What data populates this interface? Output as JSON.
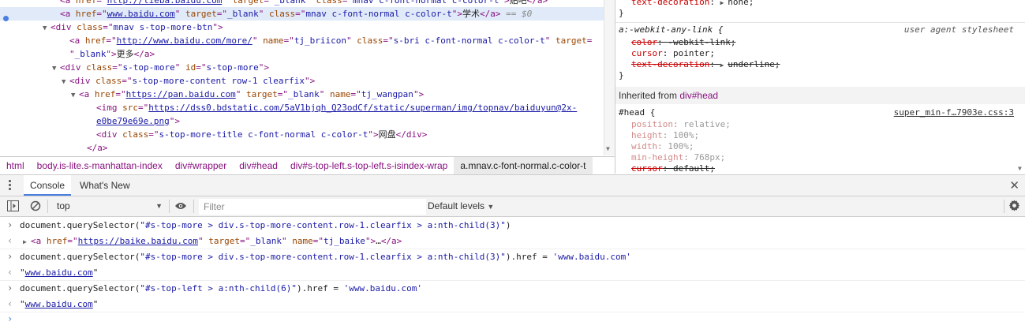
{
  "elements_panel": {
    "lines": [
      {
        "indent": 76,
        "tri": "",
        "parts": [
          [
            "tag",
            "<a "
          ],
          [
            "attr",
            "href"
          ],
          [
            "tag",
            "=\""
          ],
          [
            "url",
            "http://tieba.baidu.com"
          ],
          [
            "tag",
            "\" "
          ],
          [
            "attr",
            "target"
          ],
          [
            "tag",
            "=\""
          ],
          [
            "val",
            "_blank"
          ],
          [
            "tag",
            "\" "
          ],
          [
            "attr",
            "class"
          ],
          [
            "tag",
            "=\""
          ],
          [
            "val",
            "mnav c-font-normal c-color-t"
          ],
          [
            "tag",
            "\">"
          ],
          [
            "txt",
            "贴吧"
          ],
          [
            "tag",
            "</a>"
          ]
        ]
      },
      {
        "indent": 76,
        "tri": "",
        "parts": [
          [
            "tag",
            "<a "
          ],
          [
            "attr",
            "href"
          ],
          [
            "tag",
            "=\""
          ],
          [
            "url",
            "www.baidu.com"
          ],
          [
            "tag",
            "\" "
          ],
          [
            "attr",
            "target"
          ],
          [
            "tag",
            "=\""
          ],
          [
            "val",
            "_blank"
          ],
          [
            "tag",
            "\" "
          ],
          [
            "attr",
            "class"
          ],
          [
            "tag",
            "=\""
          ],
          [
            "val",
            "mnav c-font-normal c-color-t"
          ],
          [
            "tag",
            "\">"
          ],
          [
            "txt",
            "学术"
          ],
          [
            "tag",
            "</a>"
          ],
          [
            "dim",
            " == $0"
          ]
        ]
      },
      {
        "indent": 64,
        "tri": "▼",
        "parts": [
          [
            "tag",
            "<div "
          ],
          [
            "attr",
            "class"
          ],
          [
            "tag",
            "=\""
          ],
          [
            "val",
            "mnav s-top-more-btn"
          ],
          [
            "tag",
            "\">"
          ]
        ]
      },
      {
        "indent": 88,
        "tri": "",
        "parts": [
          [
            "tag",
            "<a "
          ],
          [
            "attr",
            "href"
          ],
          [
            "tag",
            "=\""
          ],
          [
            "url",
            "http://www.baidu.com/more/"
          ],
          [
            "tag",
            "\" "
          ],
          [
            "attr",
            "name"
          ],
          [
            "tag",
            "=\""
          ],
          [
            "val",
            "tj_briicon"
          ],
          [
            "tag",
            "\" "
          ],
          [
            "attr",
            "class"
          ],
          [
            "tag",
            "=\""
          ],
          [
            "val",
            "s-bri c-font-normal c-color-t"
          ],
          [
            "tag",
            "\" "
          ],
          [
            "attr",
            "target"
          ],
          [
            "tag",
            "="
          ]
        ]
      },
      {
        "indent": 88,
        "tri": "",
        "parts": [
          [
            "tag",
            "\""
          ],
          [
            "val",
            "_blank"
          ],
          [
            "tag",
            "\">"
          ],
          [
            "txt",
            "更多"
          ],
          [
            "tag",
            "</a>"
          ]
        ]
      },
      {
        "indent": 76,
        "tri": "▼",
        "parts": [
          [
            "tag",
            "<div "
          ],
          [
            "attr",
            "class"
          ],
          [
            "tag",
            "=\""
          ],
          [
            "val",
            "s-top-more"
          ],
          [
            "tag",
            "\" "
          ],
          [
            "attr",
            "id"
          ],
          [
            "tag",
            "=\""
          ],
          [
            "val",
            "s-top-more"
          ],
          [
            "tag",
            "\">"
          ]
        ]
      },
      {
        "indent": 88,
        "tri": "▼",
        "parts": [
          [
            "tag",
            "<div "
          ],
          [
            "attr",
            "class"
          ],
          [
            "tag",
            "=\""
          ],
          [
            "val",
            "s-top-more-content row-1 clearfix"
          ],
          [
            "tag",
            "\">"
          ]
        ]
      },
      {
        "indent": 100,
        "tri": "▼",
        "parts": [
          [
            "tag",
            "<a "
          ],
          [
            "attr",
            "href"
          ],
          [
            "tag",
            "=\""
          ],
          [
            "url",
            "https://pan.baidu.com"
          ],
          [
            "tag",
            "\" "
          ],
          [
            "attr",
            "target"
          ],
          [
            "tag",
            "=\""
          ],
          [
            "val",
            "_blank"
          ],
          [
            "tag",
            "\" "
          ],
          [
            "attr",
            "name"
          ],
          [
            "tag",
            "=\""
          ],
          [
            "val",
            "tj_wangpan"
          ],
          [
            "tag",
            "\">"
          ]
        ]
      },
      {
        "indent": 122,
        "tri": "",
        "parts": [
          [
            "tag",
            "<img "
          ],
          [
            "attr",
            "src"
          ],
          [
            "tag",
            "=\""
          ],
          [
            "url",
            "https://dss0.bdstatic.com/5aV1bjqh_Q23odCf/static/superman/img/topnav/baiduyun@2x-"
          ]
        ]
      },
      {
        "indent": 122,
        "tri": "",
        "parts": [
          [
            "url",
            "e0be79e69e.png"
          ],
          [
            "tag",
            "\">"
          ]
        ]
      },
      {
        "indent": 122,
        "tri": "",
        "parts": [
          [
            "tag",
            "<div "
          ],
          [
            "attr",
            "class"
          ],
          [
            "tag",
            "=\""
          ],
          [
            "val",
            "s-top-more-title c-font-normal c-color-t"
          ],
          [
            "tag",
            "\">"
          ],
          [
            "txt",
            "网盘"
          ],
          [
            "tag",
            "</div>"
          ]
        ]
      },
      {
        "indent": 110,
        "tri": "",
        "parts": [
          [
            "tag",
            "</a>"
          ]
        ]
      }
    ]
  },
  "styles_panel": {
    "top_rule": {
      "prop": "text-decoration",
      "value": "none;"
    },
    "top_close": "}",
    "ua_rule": {
      "selector": "a:-webkit-any-link {",
      "source": "user agent stylesheet",
      "props": [
        {
          "name": "color",
          "value": "-webkit-link;",
          "struck": true
        },
        {
          "name": "cursor",
          "value": "pointer;",
          "struck": false
        },
        {
          "name": "text-decoration",
          "value": "underline;",
          "struck": true,
          "arrow": true
        }
      ],
      "close": "}"
    },
    "inherited_label": "Inherited from ",
    "inherited_link": "div#head",
    "head_rule": {
      "selector": "#head {",
      "source": "super_min-f…7903e.css:3",
      "props": [
        {
          "name": "position",
          "value": "relative;",
          "struck": false,
          "dim": true
        },
        {
          "name": "height",
          "value": "100%;",
          "struck": false,
          "dim": true
        },
        {
          "name": "width",
          "value": "100%;",
          "struck": false,
          "dim": true
        },
        {
          "name": "min-height",
          "value": "768px;",
          "struck": false,
          "dim": true
        },
        {
          "name": "cursor",
          "value": "default;",
          "struck": true
        }
      ]
    }
  },
  "breadcrumbs": [
    {
      "label": "html",
      "selected": false
    },
    {
      "label": "body.is-lite.s-manhattan-index",
      "selected": false
    },
    {
      "label": "div#wrapper",
      "selected": false
    },
    {
      "label": "div#head",
      "selected": false
    },
    {
      "label": "div#s-top-left.s-top-left.s-isindex-wrap",
      "selected": false
    },
    {
      "label": "a.mnav.c-font-normal.c-color-t",
      "selected": true
    }
  ],
  "drawer": {
    "tabs": [
      {
        "label": "Console",
        "active": true
      },
      {
        "label": "What's New",
        "active": false
      }
    ]
  },
  "toolbar": {
    "context": "top",
    "filter_placeholder": "Filter",
    "levels": "Default levels"
  },
  "console": {
    "entries": [
      {
        "kind": "input",
        "segments": [
          [
            "cmd",
            "document.querySelector("
          ],
          [
            "jstr",
            "\"#s-top-more > div.s-top-more-content.row-1.clearfix > a:nth-child(3)\""
          ],
          [
            "cmd",
            ")"
          ]
        ]
      },
      {
        "kind": "output",
        "segments": [
          [
            "tri",
            "▶"
          ],
          [
            "tag",
            "<a "
          ],
          [
            "attr",
            "href"
          ],
          [
            "tag",
            "=\""
          ],
          [
            "url",
            "https://baike.baidu.com"
          ],
          [
            "tag",
            "\" "
          ],
          [
            "attr",
            "target"
          ],
          [
            "tag",
            "=\""
          ],
          [
            "val",
            "_blank"
          ],
          [
            "tag",
            "\" "
          ],
          [
            "attr",
            "name"
          ],
          [
            "tag",
            "=\""
          ],
          [
            "val",
            "tj_baike"
          ],
          [
            "tag",
            "\">"
          ],
          [
            "txt",
            "…"
          ],
          [
            "tag",
            "</a>"
          ]
        ]
      },
      {
        "kind": "input",
        "segments": [
          [
            "cmd",
            "document.querySelector("
          ],
          [
            "jstr",
            "\"#s-top-more > div.s-top-more-content.row-1.clearfix > a:nth-child(3)\""
          ],
          [
            "cmd",
            ").href = "
          ],
          [
            "jstr",
            "'www.baidu.com'"
          ]
        ]
      },
      {
        "kind": "output",
        "segments": [
          [
            "txt",
            "\""
          ],
          [
            "url",
            "www.baidu.com"
          ],
          [
            "txt",
            "\""
          ]
        ]
      },
      {
        "kind": "input",
        "segments": [
          [
            "cmd",
            "document.querySelector("
          ],
          [
            "jstr",
            "\"#s-top-left > a:nth-child(6)\""
          ],
          [
            "cmd",
            ").href = "
          ],
          [
            "jstr",
            "'www.baidu.com'"
          ]
        ]
      },
      {
        "kind": "output",
        "segments": [
          [
            "txt",
            "\""
          ],
          [
            "url",
            "www.baidu.com"
          ],
          [
            "txt",
            "\""
          ]
        ]
      }
    ]
  }
}
